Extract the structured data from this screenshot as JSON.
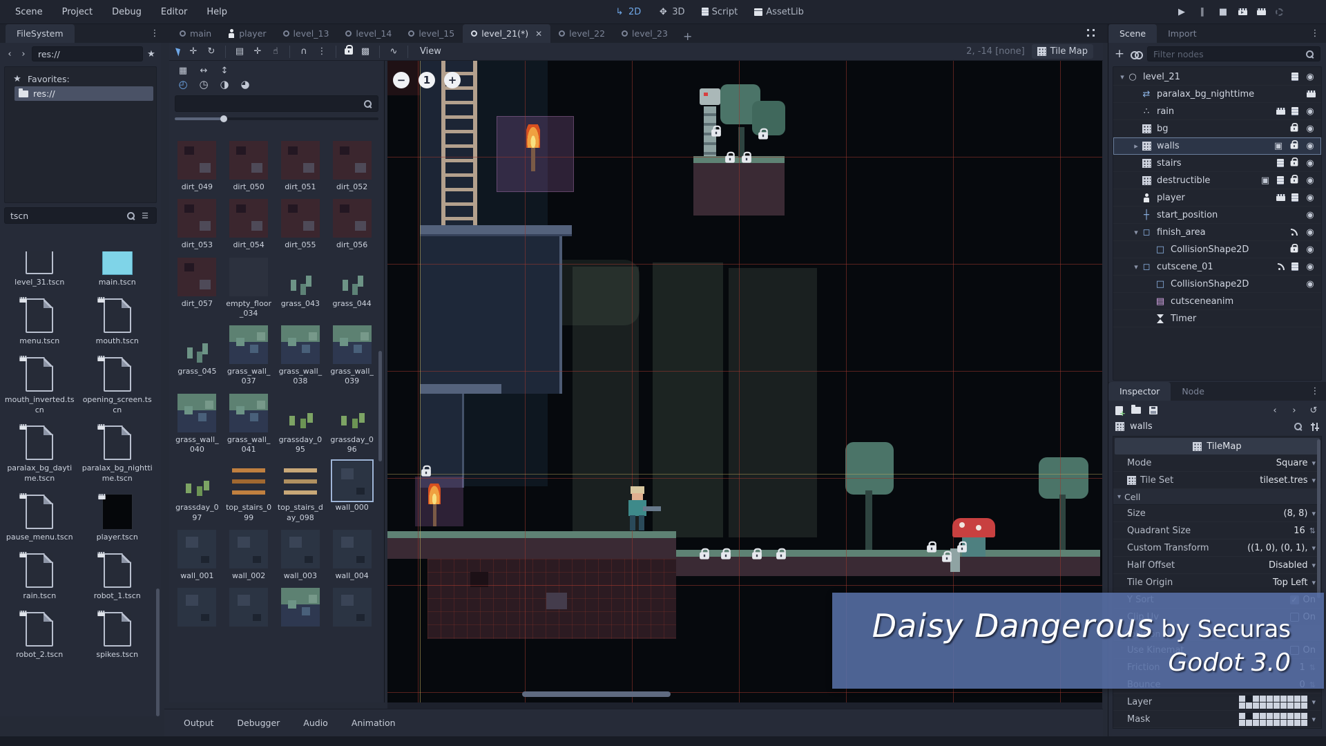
{
  "menubar": {
    "items": [
      "Scene",
      "Project",
      "Debug",
      "Editor",
      "Help"
    ]
  },
  "context_buttons": [
    {
      "label": "2D",
      "icon": "arrow-2d",
      "active": true
    },
    {
      "label": "3D",
      "icon": "axes-3d",
      "active": false
    },
    {
      "label": "Script",
      "icon": "script",
      "active": false
    },
    {
      "label": "AssetLib",
      "icon": "assetlib-box",
      "active": false
    }
  ],
  "playback": [
    "play",
    "pause",
    "stop",
    "play-scene",
    "play-custom-scene",
    "spinner"
  ],
  "scene_tabs": [
    {
      "label": "main",
      "icon": "scene-circle",
      "active": false
    },
    {
      "label": "player",
      "icon": "person",
      "active": false
    },
    {
      "label": "level_13",
      "icon": "scene-circle",
      "active": false
    },
    {
      "label": "level_14",
      "icon": "scene-circle",
      "active": false
    },
    {
      "label": "level_15",
      "icon": "scene-circle",
      "active": false
    },
    {
      "label": "level_21(*)",
      "icon": "scene-circle",
      "active": true,
      "close": "✕"
    },
    {
      "label": "level_22",
      "icon": "scene-circle",
      "active": false
    },
    {
      "label": "level_23",
      "icon": "scene-circle",
      "active": false
    }
  ],
  "tab_plus": "+",
  "toolbar2d": {
    "groups": [
      [
        "select-tool",
        "move-tool",
        "rotate-tool"
      ],
      [
        "list-select-tool",
        "pixel-snap-tool",
        "pan-tool"
      ],
      [
        "snap-magnet",
        "snap-options-dots"
      ],
      [
        "lock-object",
        "group-object"
      ],
      [
        "skeleton-bone"
      ]
    ],
    "view_menu": "View",
    "status_coords": "2, -14 [none]",
    "tilemap_button": "Tile Map"
  },
  "filesystem": {
    "dock_tab": "FileSystem",
    "path": "res://",
    "favorites_label": "Favorites:",
    "favorite_item": "res://",
    "filter_value": "tscn",
    "files": [
      {
        "name": "level_31.tscn",
        "thumb": "page"
      },
      {
        "name": "main.tscn",
        "thumb": "cyan"
      },
      {
        "name": "menu.tscn",
        "thumb": "page"
      },
      {
        "name": "mouth.tscn",
        "thumb": "page"
      },
      {
        "name": "mouth_inverted.tscn",
        "thumb": "page"
      },
      {
        "name": "opening_screen.tscn",
        "thumb": "page"
      },
      {
        "name": "paralax_bg_daytime.tscn",
        "thumb": "page"
      },
      {
        "name": "paralax_bg_nighttime.tscn",
        "thumb": "page"
      },
      {
        "name": "pause_menu.tscn",
        "thumb": "page"
      },
      {
        "name": "player.tscn",
        "thumb": "black"
      },
      {
        "name": "rain.tscn",
        "thumb": "page"
      },
      {
        "name": "robot_1.tscn",
        "thumb": "page"
      },
      {
        "name": "robot_2.tscn",
        "thumb": "page"
      },
      {
        "name": "spikes.tscn",
        "thumb": "page"
      }
    ]
  },
  "palette": {
    "mode_icons_row1": [
      "paint-tile",
      "flip-horizontal",
      "flip-vertical"
    ],
    "mode_icons_row2": [
      "rotate-0",
      "rotate-90",
      "rotate-180",
      "rotate-270"
    ],
    "tiles": [
      {
        "name": "dirt_049",
        "type": "dirt"
      },
      {
        "name": "dirt_050",
        "type": "dirt"
      },
      {
        "name": "dirt_051",
        "type": "dirt"
      },
      {
        "name": "dirt_052",
        "type": "dirt"
      },
      {
        "name": "dirt_053",
        "type": "dirt"
      },
      {
        "name": "dirt_054",
        "type": "dirt"
      },
      {
        "name": "dirt_055",
        "type": "dirt"
      },
      {
        "name": "dirt_056",
        "type": "dirt"
      },
      {
        "name": "dirt_057",
        "type": "dirt"
      },
      {
        "name": "empty_floor_034",
        "type": "empty"
      },
      {
        "name": "grass_043",
        "type": "grass"
      },
      {
        "name": "grass_044",
        "type": "grass"
      },
      {
        "name": "grass_045",
        "type": "grass"
      },
      {
        "name": "grass_wall_037",
        "type": "grasswall"
      },
      {
        "name": "grass_wall_038",
        "type": "grasswall"
      },
      {
        "name": "grass_wall_039",
        "type": "grasswall"
      },
      {
        "name": "grass_wall_040",
        "type": "grasswall"
      },
      {
        "name": "grass_wall_041",
        "type": "grasswall"
      },
      {
        "name": "grassday_095",
        "type": "grassday"
      },
      {
        "name": "grassday_096",
        "type": "grassday"
      },
      {
        "name": "grassday_097",
        "type": "grassday"
      },
      {
        "name": "top_stairs_099",
        "type": "stairs"
      },
      {
        "name": "top_stairs_day_098",
        "type": "stairsday"
      },
      {
        "name": "wall_000",
        "type": "wall",
        "selected": true
      },
      {
        "name": "wall_001",
        "type": "wall"
      },
      {
        "name": "wall_002",
        "type": "wall"
      },
      {
        "name": "wall_003",
        "type": "wall"
      },
      {
        "name": "wall_004",
        "type": "wall"
      },
      {
        "name": "",
        "type": "wall"
      },
      {
        "name": "",
        "type": "wall"
      },
      {
        "name": "",
        "type": "grasswall"
      },
      {
        "name": "",
        "type": "wall"
      }
    ]
  },
  "viewport": {
    "zoom_out": "−",
    "zoom_reset": "1",
    "zoom_in": "+"
  },
  "scene_dock": {
    "tabs": [
      {
        "label": "Scene",
        "active": true
      },
      {
        "label": "Import",
        "active": false
      }
    ],
    "filter_placeholder": "Filter nodes",
    "nodes": [
      {
        "name": "level_21",
        "icon": "scene-circle",
        "depth": 0,
        "expander": "▾",
        "badges": [
          "script",
          "eye"
        ]
      },
      {
        "name": "paralax_bg_nighttime",
        "icon": "parallax",
        "depth": 1,
        "badges": [
          "clapper"
        ]
      },
      {
        "name": "rain",
        "icon": "particles",
        "depth": 1,
        "badges": [
          "clapper",
          "script",
          "eye"
        ]
      },
      {
        "name": "bg",
        "icon": "tilemap",
        "depth": 1,
        "badges": [
          "lock",
          "eye"
        ]
      },
      {
        "name": "walls",
        "icon": "tilemap",
        "depth": 1,
        "expander": "▸",
        "selected": true,
        "badges": [
          "group",
          "lock",
          "eye"
        ]
      },
      {
        "name": "stairs",
        "icon": "tilemap",
        "depth": 1,
        "badges": [
          "script",
          "lock",
          "eye"
        ]
      },
      {
        "name": "destructible",
        "icon": "tilemap",
        "depth": 1,
        "badges": [
          "group",
          "script",
          "lock",
          "eye"
        ]
      },
      {
        "name": "player",
        "icon": "person",
        "depth": 1,
        "badges": [
          "clapper",
          "script",
          "eye"
        ]
      },
      {
        "name": "start_position",
        "icon": "position",
        "depth": 1,
        "badges": [
          "eye"
        ]
      },
      {
        "name": "finish_area",
        "icon": "area",
        "depth": 1,
        "expander": "▾",
        "badges": [
          "signal",
          "eye"
        ]
      },
      {
        "name": "CollisionShape2D",
        "icon": "shape",
        "depth": 2,
        "badges": [
          "lock",
          "eye"
        ]
      },
      {
        "name": "cutscene_01",
        "icon": "area",
        "depth": 1,
        "expander": "▾",
        "badges": [
          "signal",
          "script",
          "eye"
        ]
      },
      {
        "name": "CollisionShape2D",
        "icon": "shape",
        "depth": 2,
        "badges": [
          "eye"
        ]
      },
      {
        "name": "cutsceneanim",
        "icon": "film",
        "depth": 2,
        "badges": []
      },
      {
        "name": "Timer",
        "icon": "timer",
        "depth": 2,
        "badges": []
      }
    ]
  },
  "inspector": {
    "tabs": [
      {
        "label": "Inspector",
        "active": true
      },
      {
        "label": "Node",
        "active": false
      }
    ],
    "object_name": "walls",
    "header": "TileMap",
    "rows": [
      {
        "kind": "prop",
        "label": "Mode",
        "value": "Square",
        "control": "dropdown"
      },
      {
        "kind": "prop",
        "label": "Tile Set",
        "value": "tileset.tres",
        "control": "dropdown",
        "icon": "tileset"
      },
      {
        "kind": "section",
        "label": "Cell"
      },
      {
        "kind": "prop",
        "label": "Size",
        "value": "(8, 8)",
        "control": "dropdown"
      },
      {
        "kind": "prop",
        "label": "Quadrant Size",
        "value": "16",
        "control": "spinner"
      },
      {
        "kind": "prop",
        "label": "Custom Transform",
        "value": "((1, 0), (0, 1),",
        "control": "dropdown"
      },
      {
        "kind": "prop",
        "label": "Half Offset",
        "value": "Disabled",
        "control": "dropdown"
      },
      {
        "kind": "prop",
        "label": "Tile Origin",
        "value": "Top Left",
        "control": "dropdown"
      },
      {
        "kind": "prop",
        "label": "Y Sort",
        "value": "On",
        "control": "checkbox",
        "checked": true
      },
      {
        "kind": "prop",
        "label": "Clip Uv",
        "value": "On",
        "control": "checkbox",
        "checked": false
      },
      {
        "kind": "section",
        "label": "Collision"
      },
      {
        "kind": "prop",
        "label": "Use Kinemat",
        "value": "On",
        "control": "checkbox",
        "checked": false
      },
      {
        "kind": "prop",
        "label": "Friction",
        "value": "1",
        "control": "spinner"
      },
      {
        "kind": "prop",
        "label": "Bounce",
        "value": "0",
        "control": "spinner"
      },
      {
        "kind": "prop",
        "label": "Layer",
        "control": "bitmask"
      },
      {
        "kind": "prop",
        "label": "Mask",
        "control": "bitmask"
      }
    ]
  },
  "bottom_tabs": [
    "Output",
    "Debugger",
    "Audio",
    "Animation"
  ],
  "banner": {
    "title": "Daisy Dangerous",
    "byline": " by Securas",
    "version": "Godot 3.0"
  },
  "colors": {
    "accent": "#6fa8e8",
    "banner_blue": "#5872a8",
    "grid_red": "#9b372d",
    "guide_yellow": "#c3af5f"
  },
  "icons": {
    "arrow-2d": "↳",
    "axes-3d": "✥",
    "script": "css:c-script",
    "assetlib-box": "css:c-box",
    "play": "▶",
    "pause": "∥",
    "stop": "■",
    "play-scene": "css:c-clapper play",
    "play-custom-scene": "css:c-clapper",
    "spinner": "css:c-spin",
    "scene-circle": "circ",
    "person": "css:c-person",
    "select-tool": "css:c-cursor",
    "move-tool": "✛",
    "rotate-tool": "↻",
    "list-select-tool": "▤",
    "pixel-snap-tool": "✛",
    "pan-tool": "☝",
    "snap-magnet": "∩",
    "snap-options-dots": "⋮",
    "lock-object": "css:c-lock",
    "group-object": "▩",
    "skeleton-bone": "∿",
    "back": "‹",
    "forward": "›",
    "star": "★",
    "dots": "⋮",
    "search": "css:c-mag",
    "folder": "css:c-folder",
    "list-view": "☰",
    "paint-tile": "▦",
    "flip-horizontal": "↔",
    "flip-vertical": "↕",
    "rotate-0": "◴",
    "rotate-90": "◷",
    "rotate-180": "◑",
    "rotate-270": "◕",
    "add-node": "+",
    "instance-scene": "css:c-link",
    "clapper": "css:c-clapper",
    "lock": "css:c-lock",
    "eye": "◉",
    "group": "▣",
    "signal": "css:c-signal",
    "tilemap": "css:c-grid12",
    "parallax": "⇄",
    "particles": "∴",
    "position": "┼",
    "area": "◻",
    "shape": "□",
    "film": "▤",
    "timer": "css:c-timer",
    "new-resource": "css:c-pageplus",
    "load-resource": "css:c-folder",
    "save-resource": "css:c-floppy",
    "history": "↺",
    "tools": "css:c-tools",
    "tileset": "css:c-grid12",
    "distraction-free": "css:c-fullscreen",
    "checkmark": "✓",
    "dropdown": "▾",
    "spinner-updown": "⇅"
  }
}
